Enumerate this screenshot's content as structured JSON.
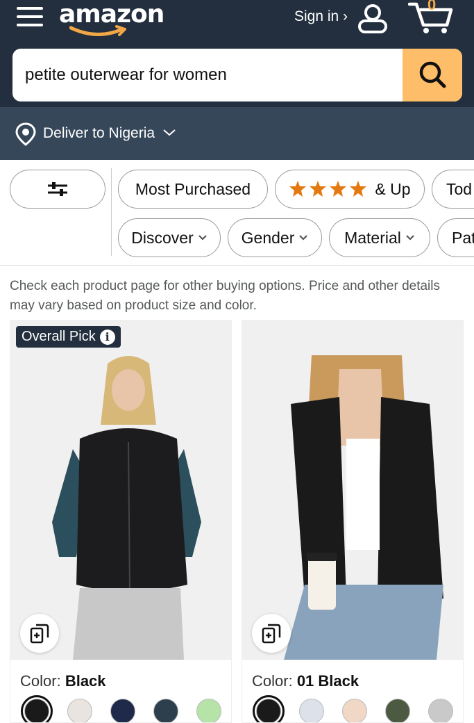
{
  "header": {
    "logo_text": "amazon",
    "signin_label": "Sign in ›",
    "cart_count": "0"
  },
  "search": {
    "query": "petite outerwear for women"
  },
  "delivery": {
    "label": "Deliver to Nigeria"
  },
  "filters": {
    "row1": [
      {
        "label": "Most Purchased"
      },
      {
        "label": "& Up",
        "stars": 4
      },
      {
        "label": "Tod"
      }
    ],
    "row2": [
      {
        "label": "Discover"
      },
      {
        "label": "Gender"
      },
      {
        "label": "Material"
      },
      {
        "label": "Pat"
      }
    ]
  },
  "notice": "Check each product page for other buying options. Price and other details may vary based on product size and color.",
  "products": [
    {
      "badge": "Overall Pick",
      "color_prefix": "Color:",
      "color_value": "Black",
      "swatches": [
        "#1a1a1a",
        "#e9e4df",
        "#1f2a4a",
        "#2d3e4c",
        "#b6e3a8"
      ]
    },
    {
      "badge": "",
      "color_prefix": "Color:",
      "color_value": "01 Black",
      "swatches": [
        "#1a1a1a",
        "#dde2ea",
        "#f1d7c6",
        "#4d5a42",
        "#c9c9c9"
      ]
    }
  ],
  "colors": {
    "header_bg": "#232f3e",
    "delivery_bg": "#37475a",
    "search_button": "#febd69",
    "star": "#e47911"
  }
}
